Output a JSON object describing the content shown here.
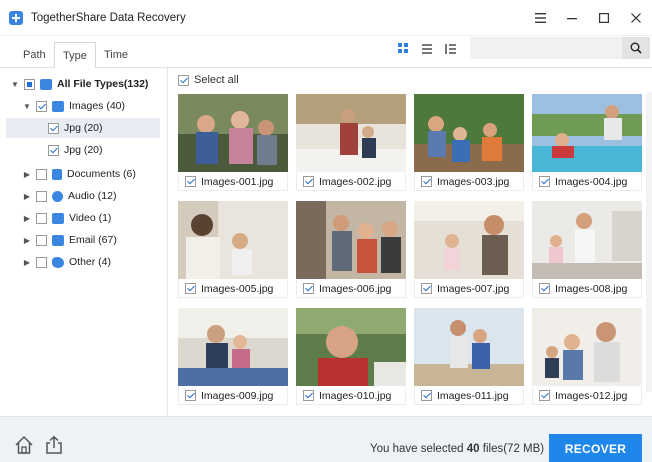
{
  "window": {
    "title": "TogetherShare Data Recovery",
    "controls": [
      "menu-icon",
      "minimize-icon",
      "maximize-icon",
      "close-icon"
    ]
  },
  "tabs": [
    {
      "label": "Path",
      "active": false
    },
    {
      "label": "Type",
      "active": true
    },
    {
      "label": "Time",
      "active": false
    }
  ],
  "search": {
    "placeholder": ""
  },
  "tree": {
    "root": {
      "label": "All File Types(132)",
      "state": "partial"
    },
    "images": {
      "label": "Images (40)",
      "state": "checked"
    },
    "jpg_selected": {
      "label": "Jpg (20)",
      "state": "checked"
    },
    "jpg_other": {
      "label": "Jpg (20)",
      "state": "checked"
    },
    "documents": {
      "label": "Documents (6)",
      "state": "unchecked"
    },
    "audio": {
      "label": "Audio (12)",
      "state": "unchecked"
    },
    "video": {
      "label": "Video (1)",
      "state": "unchecked"
    },
    "email": {
      "label": "Email (67)",
      "state": "unchecked"
    },
    "other": {
      "label": "Other (4)",
      "state": "unchecked"
    }
  },
  "grid": {
    "select_all_label": "Select all",
    "items": [
      {
        "name": "Images-001.jpg",
        "checked": true
      },
      {
        "name": "Images-002.jpg",
        "checked": true
      },
      {
        "name": "Images-003.jpg",
        "checked": true
      },
      {
        "name": "Images-004.jpg",
        "checked": true
      },
      {
        "name": "Images-005.jpg",
        "checked": true
      },
      {
        "name": "Images-006.jpg",
        "checked": true
      },
      {
        "name": "Images-007.jpg",
        "checked": true
      },
      {
        "name": "Images-008.jpg",
        "checked": true
      },
      {
        "name": "Images-009.jpg",
        "checked": true
      },
      {
        "name": "Images-010.jpg",
        "checked": true
      },
      {
        "name": "Images-011.jpg",
        "checked": true
      },
      {
        "name": "Images-012.jpg",
        "checked": true
      }
    ]
  },
  "footer": {
    "status_prefix": "You have selected",
    "count": "40",
    "status_suffix": "files(72 MB)",
    "recover_label": "RECOVER"
  },
  "colors": {
    "accent": "#1f86ec",
    "check": "#1e6ed6",
    "footer_bg": "#eef1f5"
  }
}
